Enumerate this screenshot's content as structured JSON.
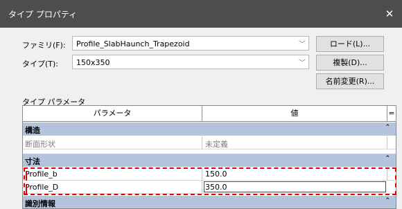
{
  "dialog": {
    "title": "タイプ プロパティ",
    "close_glyph": "✕"
  },
  "family": {
    "label": "ファミリ(F):",
    "value": "Profile_SlabHaunch_Trapezoid"
  },
  "type": {
    "label": "タイプ(T):",
    "value": "150x350"
  },
  "buttons": {
    "load": "ロード(L)...",
    "duplicate": "複製(D)...",
    "rename": "名前変更(R)..."
  },
  "type_params_label": "タイプ パラメータ",
  "grid": {
    "header": {
      "param": "パラメータ",
      "value": "値",
      "sort": "="
    },
    "groups": [
      {
        "name": "構造",
        "rows": [
          {
            "name": "断面形状",
            "value": "未定義"
          }
        ]
      },
      {
        "name": "寸法",
        "rows": [
          {
            "name": "Profile_b",
            "value": "150.0"
          },
          {
            "name": "Profile_D",
            "value": "350.0"
          }
        ]
      },
      {
        "name": "識別情報",
        "rows": []
      }
    ]
  },
  "icons": {
    "dropdown": "chevron-down-icon",
    "collapse": "collapse-icon"
  },
  "colors": {
    "titlebar": "#4d4d4d",
    "group_header": "#b3c4dc",
    "highlight": "#e00000"
  }
}
